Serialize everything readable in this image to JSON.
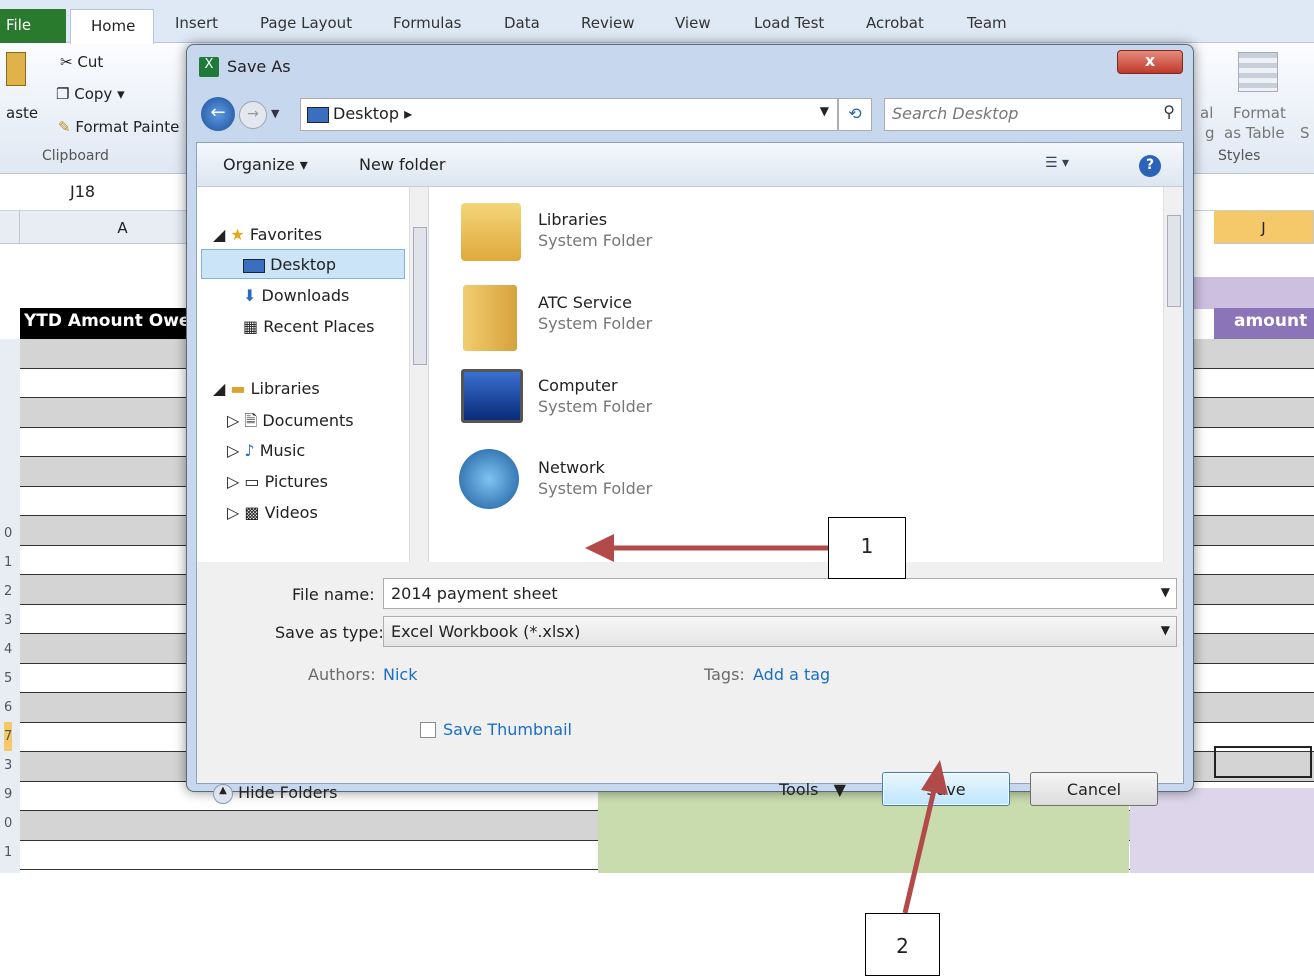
{
  "ribbon": {
    "tabs": [
      "File",
      "Home",
      "Insert",
      "Page Layout",
      "Formulas",
      "Data",
      "Review",
      "View",
      "Load Test",
      "Acrobat",
      "Team"
    ],
    "clipboard": {
      "paste": "aste",
      "cut": "Cut",
      "copy": "Copy",
      "format_painter": "Format Painte",
      "group": "Clipboard"
    },
    "styles": {
      "al": "al",
      "format_as_table_1": "Format",
      "format_as_table_2": "as Table",
      "s": "S",
      "group": "Styles",
      "g": "g"
    }
  },
  "name_box": "J18",
  "sheet": {
    "col_a": "A",
    "col_j": "J",
    "header_left": "YTD Amount Owe",
    "header_right": "amount",
    "row_numbers": [
      "0",
      "1",
      "2",
      "3",
      "4",
      "5",
      "6",
      "7",
      "3",
      "9",
      "0",
      "1"
    ]
  },
  "dialog": {
    "title": "Save As",
    "close": "x",
    "address": "Desktop",
    "search_placeholder": "Search Desktop",
    "toolbar": {
      "organize": "Organize",
      "new_folder": "New folder"
    },
    "nav": {
      "favorites": "Favorites",
      "desktop": "Desktop",
      "downloads": "Downloads",
      "recent": "Recent Places",
      "libraries": "Libraries",
      "documents": "Documents",
      "music": "Music",
      "pictures": "Pictures",
      "videos": "Videos"
    },
    "items": [
      {
        "name": "Libraries",
        "type": "System Folder"
      },
      {
        "name": "ATC Service",
        "type": "System Folder"
      },
      {
        "name": "Computer",
        "type": "System Folder"
      },
      {
        "name": "Network",
        "type": "System Folder"
      }
    ],
    "file_name_label": "File name:",
    "file_name_value": "2014 payment sheet",
    "save_type_label": "Save as type:",
    "save_type_value": "Excel Workbook (*.xlsx)",
    "authors_label": "Authors:",
    "authors_value": "Nick",
    "tags_label": "Tags:",
    "tags_value": "Add a tag",
    "save_thumbnail": "Save Thumbnail",
    "hide_folders": "Hide Folders",
    "tools": "Tools",
    "save": "Save",
    "cancel": "Cancel"
  },
  "callouts": {
    "one": "1",
    "two": "2"
  },
  "colors": {
    "excel_green": "#2a7a2e",
    "dialog_frame": "#c7d8ee",
    "arrow": "#b24a4a",
    "link": "#1a6fc4",
    "selection": "#cce4f7"
  }
}
